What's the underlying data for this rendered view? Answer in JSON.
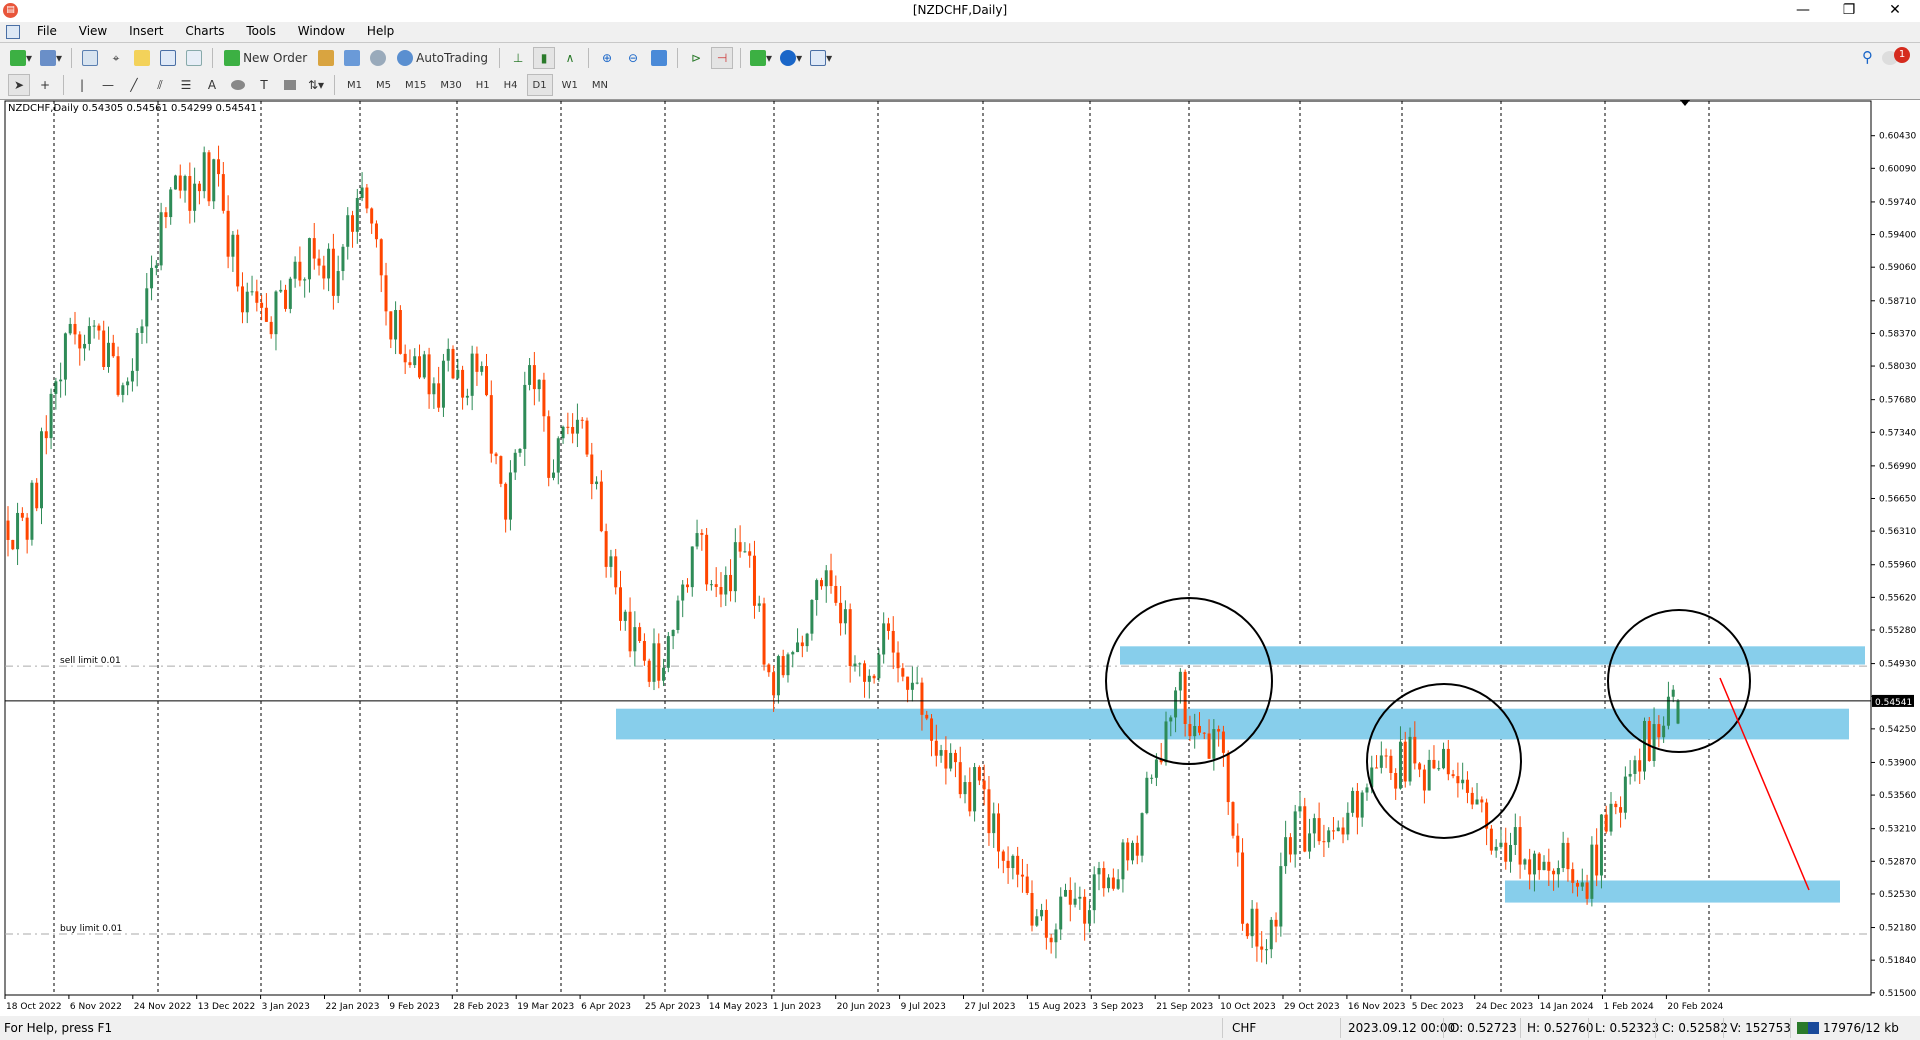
{
  "window": {
    "title": "[NZDCHF,Daily]",
    "app_icon": "metatrader-icon"
  },
  "menu": [
    "File",
    "View",
    "Insert",
    "Charts",
    "Tools",
    "Window",
    "Help"
  ],
  "toolbar1": {
    "new_order": "New Order",
    "autotrading": "AutoTrading"
  },
  "timeframes": [
    "M1",
    "M5",
    "M15",
    "M30",
    "H1",
    "H4",
    "D1",
    "W1",
    "MN"
  ],
  "active_timeframe": "D1",
  "notifications": {
    "count": "1"
  },
  "chart": {
    "header": "NZDCHF,Daily  0.54305 0.54561 0.54299 0.54541",
    "sell_label": "sell limit 0.01",
    "buy_label": "buy limit 0.01",
    "current_price_label": "0.54541"
  },
  "chart_data": {
    "type": "candlestick",
    "symbol": "NZDCHF",
    "timeframe": "Daily",
    "last_bar": {
      "open": 0.54305,
      "high": 0.54561,
      "low": 0.54299,
      "close": 0.54541
    },
    "weekly_closes_approx": [
      0.5622,
      0.5774,
      0.5836,
      0.584,
      0.5783,
      0.5884,
      0.5987,
      0.5993,
      0.6003,
      0.5859,
      0.5849,
      0.5894,
      0.5915,
      0.5902,
      0.5989,
      0.586,
      0.5804,
      0.5785,
      0.5799,
      0.5803,
      0.5643,
      0.5804,
      0.5692,
      0.5747,
      0.5631,
      0.5547,
      0.5474,
      0.5528,
      0.5629,
      0.5565,
      0.561,
      0.5484,
      0.5505,
      0.558,
      0.5535,
      0.5474,
      0.5527,
      0.5473,
      0.5397,
      0.5357,
      0.5362,
      0.528,
      0.522,
      0.5216,
      0.525,
      0.5259,
      0.5288,
      0.5374,
      0.5465,
      0.5421,
      0.54,
      0.5209,
      0.5226,
      0.5339,
      0.5308,
      0.5315,
      0.5364,
      0.5379,
      0.5389,
      0.5384,
      0.5372,
      0.5321,
      0.5304,
      0.5295,
      0.528,
      0.5265,
      0.5318,
      0.5378,
      0.543,
      0.54541
    ],
    "ylim": [
      0.515,
      0.6043
    ],
    "y_ticks": [
      "0.60430",
      "0.60090",
      "0.59740",
      "0.59400",
      "0.59060",
      "0.58710",
      "0.58370",
      "0.58030",
      "0.57680",
      "0.57340",
      "0.56990",
      "0.56650",
      "0.56310",
      "0.55960",
      "0.55620",
      "0.55280",
      "0.54930",
      "0.54590",
      "0.54250",
      "0.53900",
      "0.53560",
      "0.53210",
      "0.52870",
      "0.52530",
      "0.52180",
      "0.51840",
      "0.51500"
    ],
    "x_ticks": [
      "18 Oct 2022",
      "6 Nov 2022",
      "24 Nov 2022",
      "13 Dec 2022",
      "3 Jan 2023",
      "22 Jan 2023",
      "9 Feb 2023",
      "28 Feb 2023",
      "19 Mar 2023",
      "6 Apr 2023",
      "25 Apr 2023",
      "14 May 2023",
      "1 Jun 2023",
      "20 Jun 2023",
      "9 Jul 2023",
      "27 Jul 2023",
      "15 Aug 2023",
      "3 Sep 2023",
      "21 Sep 2023",
      "10 Oct 2023",
      "29 Oct 2023",
      "16 Nov 2023",
      "5 Dec 2023",
      "24 Dec 2023",
      "14 Jan 2024",
      "1 Feb 2024",
      "20 Feb 2024"
    ],
    "sell_limit_price": 0.54904,
    "buy_limit_price": 0.52112,
    "zones": [
      {
        "top": 0.5511,
        "bottom": 0.5492
      },
      {
        "top": 0.5446,
        "bottom": 0.5414
      },
      {
        "top": 0.5267,
        "bottom": 0.5244
      }
    ],
    "colors": {
      "bull": "#2e8b57",
      "bear": "#ff4500",
      "zone": "#87ceeb",
      "arrow": "#ff0000",
      "grid": "#000000"
    },
    "grid": true
  },
  "status": {
    "help": "For Help, press F1",
    "currency": "CHF",
    "datetime": "2023.09.12 00:00",
    "open": "O: 0.52723",
    "high": "H: 0.52760",
    "low": "L: 0.52323",
    "close": "C: 0.52582",
    "volume": "V: 152753",
    "traffic": "17976/12 kb"
  }
}
